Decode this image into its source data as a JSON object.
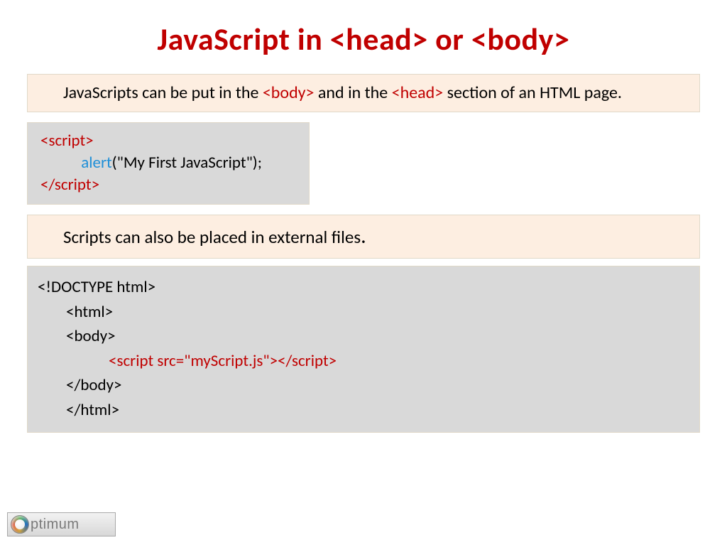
{
  "title": "JavaScript in <head> or <body>",
  "intro": {
    "pre": "JavaScripts can be put in the ",
    "tag1": "<body>",
    "mid1": " and in the ",
    "tag2": "<head>",
    "post": " section of an HTML page."
  },
  "code1": {
    "open": "<script>",
    "call": "alert",
    "args": "(\"My First JavaScript\");",
    "close": "</script>"
  },
  "externalText": "Scripts can also be placed in external files",
  "period": ".",
  "code2": {
    "doctype": "<!DOCTYPE html>",
    "htmlOpen": "<html>",
    "bodyOpen": "<body>",
    "scriptLine": "<script  src=\"myScript.js\"></script>",
    "bodyClose": "</body>",
    "htmlClose": "</html>"
  },
  "logoText": "ptimum"
}
